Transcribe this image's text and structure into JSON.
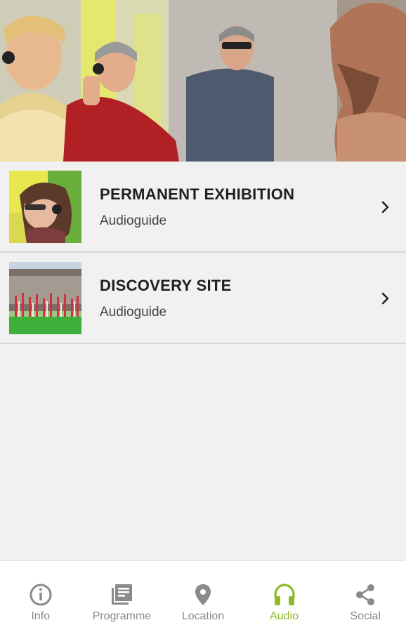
{
  "hero": {
    "image": "visitors-with-audioguide-headphones-photo"
  },
  "list": {
    "items": [
      {
        "title": "PERMANENT EXHIBITION",
        "subtitle": "Audioguide",
        "thumbnail": "woman-with-headphones-photo"
      },
      {
        "title": "DISCOVERY SITE",
        "subtitle": "Audioguide",
        "thumbnail": "park-with-red-poles-photo"
      }
    ]
  },
  "nav": {
    "items": [
      {
        "label": "Info",
        "icon": "info-icon"
      },
      {
        "label": "Programme",
        "icon": "programme-icon"
      },
      {
        "label": "Location",
        "icon": "location-pin-icon"
      },
      {
        "label": "Audio",
        "icon": "headphones-icon"
      },
      {
        "label": "Social",
        "icon": "share-icon"
      }
    ],
    "active": "Audio",
    "colors": {
      "active": "#8dba2a",
      "inactive": "#8a8a8a"
    }
  }
}
